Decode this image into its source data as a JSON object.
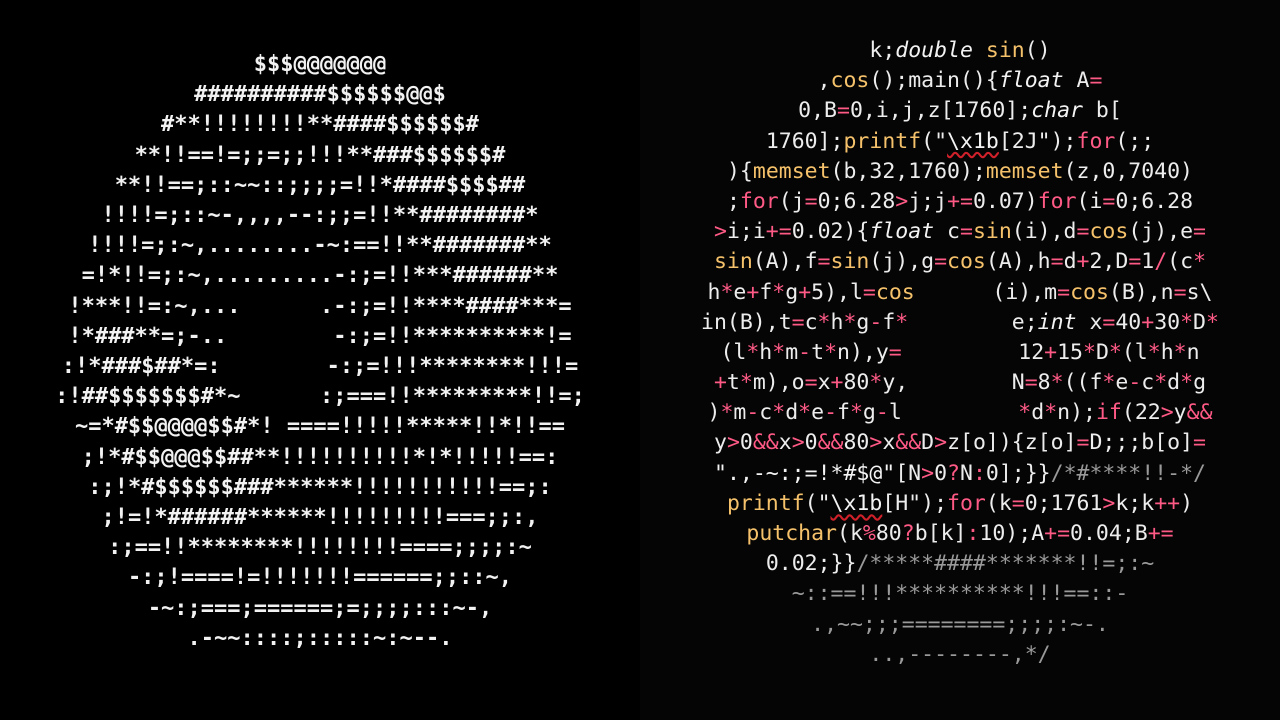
{
  "left_ascii": {
    "lines": [
      "$$$@@@@@@@",
      "##########$$$$$$@@$",
      "#**!!!!!!!!**####$$$$$$#",
      "**!!==!=;;=;;!!!**###$$$$$$#",
      "**!!==;::~~::;;;;=!!*####$$$$##",
      "!!!!=;::~-,,,,--:;;=!!**########*",
      "!!!!=;:~,........-~:==!!**#######**",
      "=!*!!=;:~,.........-:;=!!***######**",
      "!***!!=:~,...      .-:;=!!****####***=",
      "!*###**=;-..        -:;=!!**********!=",
      ":!*###$##*=:        -:;=!!!********!!!=",
      ":!##$$$$$$$#*~      :;===!!*********!!=;",
      "~=*#$$@@@@$$#*! ====!!!!!*****!!*!!==",
      ";!*#$$@@@$$##**!!!!!!!!!!*!*!!!!!==:",
      ":;!*#$$$$$$###******!!!!!!!!!!!==;:",
      ";!=!*######******!!!!!!!!!===;;:,",
      ":;==!!********!!!!!!!!====;;;;:~",
      "-:;!====!=!!!!!!!======;;::~,",
      "-~:;===;======;=;;;;:::~-,",
      ".-~~::::;:::::~:~--."
    ]
  },
  "right_code": {
    "lines": [
      [
        [
          "t",
          "k;"
        ],
        [
          "it",
          "double"
        ],
        [
          "t",
          " "
        ],
        [
          "fn",
          "sin"
        ],
        [
          "t",
          "()"
        ]
      ],
      [
        [
          "t",
          ","
        ],
        [
          "fn",
          "cos"
        ],
        [
          "t",
          "();main(){"
        ],
        [
          "it",
          "float"
        ],
        [
          "t",
          " A"
        ],
        [
          "op",
          "="
        ]
      ],
      [
        [
          "t",
          "0,B"
        ],
        [
          "op",
          "="
        ],
        [
          "t",
          "0,i,j,z[1760];"
        ],
        [
          "it",
          "char"
        ],
        [
          "t",
          " b["
        ]
      ],
      [
        [
          "t",
          "1760];"
        ],
        [
          "fn",
          "printf"
        ],
        [
          "t",
          "(\""
        ],
        [
          "esc",
          "\\x1b"
        ],
        [
          "t",
          "[2J\");"
        ],
        [
          "kw",
          "for"
        ],
        [
          "t",
          "(;;"
        ]
      ],
      [
        [
          "t",
          ")"
        ],
        [
          "t",
          "{"
        ],
        [
          "fn",
          "memset"
        ],
        [
          "t",
          "(b,32,1760);"
        ],
        [
          "fn",
          "memset"
        ],
        [
          "t",
          "(z,0,7040)"
        ]
      ],
      [
        [
          "t",
          ";"
        ],
        [
          "kw",
          "for"
        ],
        [
          "t",
          "(j"
        ],
        [
          "op",
          "="
        ],
        [
          "t",
          "0;6.28"
        ],
        [
          "op",
          ">"
        ],
        [
          "t",
          "j;j"
        ],
        [
          "op",
          "+="
        ],
        [
          "t",
          "0.07)"
        ],
        [
          "kw",
          "for"
        ],
        [
          "t",
          "(i"
        ],
        [
          "op",
          "="
        ],
        [
          "t",
          "0;6.28"
        ]
      ],
      [
        [
          "op",
          ">"
        ],
        [
          "t",
          "i;i"
        ],
        [
          "op",
          "+="
        ],
        [
          "t",
          "0.02){"
        ],
        [
          "it",
          "float"
        ],
        [
          "t",
          " c"
        ],
        [
          "op",
          "="
        ],
        [
          "fn",
          "sin"
        ],
        [
          "t",
          "(i),d"
        ],
        [
          "op",
          "="
        ],
        [
          "fn",
          "cos"
        ],
        [
          "t",
          "(j),e"
        ],
        [
          "op",
          "="
        ]
      ],
      [
        [
          "fn",
          "sin"
        ],
        [
          "t",
          "(A),f"
        ],
        [
          "op",
          "="
        ],
        [
          "fn",
          "sin"
        ],
        [
          "t",
          "(j),g"
        ],
        [
          "op",
          "="
        ],
        [
          "fn",
          "cos"
        ],
        [
          "t",
          "(A),h"
        ],
        [
          "op",
          "="
        ],
        [
          "t",
          "d"
        ],
        [
          "op",
          "+"
        ],
        [
          "t",
          "2,D"
        ],
        [
          "op",
          "="
        ],
        [
          "t",
          "1"
        ],
        [
          "op",
          "/"
        ],
        [
          "t",
          "(c"
        ],
        [
          "op",
          "*"
        ]
      ],
      [
        [
          "t",
          "h"
        ],
        [
          "op",
          "*"
        ],
        [
          "t",
          "e"
        ],
        [
          "op",
          "+"
        ],
        [
          "t",
          "f"
        ],
        [
          "op",
          "*"
        ],
        [
          "t",
          "g"
        ],
        [
          "op",
          "+"
        ],
        [
          "t",
          "5),l"
        ],
        [
          "op",
          "="
        ],
        [
          "fn",
          "cos"
        ],
        [
          "t",
          "      (i),m"
        ],
        [
          "op",
          "="
        ],
        [
          "fn",
          "cos"
        ],
        [
          "t",
          "(B),n"
        ],
        [
          "op",
          "="
        ],
        [
          "t",
          "s\\"
        ]
      ],
      [
        [
          "t",
          "in(B),t"
        ],
        [
          "op",
          "="
        ],
        [
          "t",
          "c"
        ],
        [
          "op",
          "*"
        ],
        [
          "t",
          "h"
        ],
        [
          "op",
          "*"
        ],
        [
          "t",
          "g"
        ],
        [
          "op",
          "-"
        ],
        [
          "t",
          "f"
        ],
        [
          "op",
          "*"
        ],
        [
          "t",
          "        e;"
        ],
        [
          "it",
          "int"
        ],
        [
          "t",
          " x"
        ],
        [
          "op",
          "="
        ],
        [
          "t",
          "40"
        ],
        [
          "op",
          "+"
        ],
        [
          "t",
          "30"
        ],
        [
          "op",
          "*"
        ],
        [
          "t",
          "D"
        ],
        [
          "op",
          "*"
        ]
      ],
      [
        [
          "t",
          "(l"
        ],
        [
          "op",
          "*"
        ],
        [
          "t",
          "h"
        ],
        [
          "op",
          "*"
        ],
        [
          "t",
          "m"
        ],
        [
          "op",
          "-"
        ],
        [
          "t",
          "t"
        ],
        [
          "op",
          "*"
        ],
        [
          "t",
          "n),y"
        ],
        [
          "op",
          "="
        ],
        [
          "t",
          "         12"
        ],
        [
          "op",
          "+"
        ],
        [
          "t",
          "15"
        ],
        [
          "op",
          "*"
        ],
        [
          "t",
          "D"
        ],
        [
          "op",
          "*"
        ],
        [
          "t",
          "(l"
        ],
        [
          "op",
          "*"
        ],
        [
          "t",
          "h"
        ],
        [
          "op",
          "*"
        ],
        [
          "t",
          "n"
        ]
      ],
      [
        [
          "op",
          "+"
        ],
        [
          "t",
          "t"
        ],
        [
          "op",
          "*"
        ],
        [
          "t",
          "m),o"
        ],
        [
          "op",
          "="
        ],
        [
          "t",
          "x"
        ],
        [
          "op",
          "+"
        ],
        [
          "t",
          "80"
        ],
        [
          "op",
          "*"
        ],
        [
          "t",
          "y,        N"
        ],
        [
          "op",
          "="
        ],
        [
          "t",
          "8"
        ],
        [
          "op",
          "*"
        ],
        [
          "t",
          "((f"
        ],
        [
          "op",
          "*"
        ],
        [
          "t",
          "e"
        ],
        [
          "op",
          "-"
        ],
        [
          "t",
          "c"
        ],
        [
          "op",
          "*"
        ],
        [
          "t",
          "d"
        ],
        [
          "op",
          "*"
        ],
        [
          "t",
          "g"
        ]
      ],
      [
        [
          "t",
          ")"
        ],
        [
          "op",
          "*"
        ],
        [
          "t",
          "m"
        ],
        [
          "op",
          "-"
        ],
        [
          "t",
          "c"
        ],
        [
          "op",
          "*"
        ],
        [
          "t",
          "d"
        ],
        [
          "op",
          "*"
        ],
        [
          "t",
          "e"
        ],
        [
          "op",
          "-"
        ],
        [
          "t",
          "f"
        ],
        [
          "op",
          "*"
        ],
        [
          "t",
          "g"
        ],
        [
          "op",
          "-"
        ],
        [
          "t",
          "l         "
        ],
        [
          "op",
          "*"
        ],
        [
          "t",
          "d"
        ],
        [
          "op",
          "*"
        ],
        [
          "t",
          "n);"
        ],
        [
          "kw",
          "if"
        ],
        [
          "t",
          "(22"
        ],
        [
          "op",
          ">"
        ],
        [
          "t",
          "y"
        ],
        [
          "op",
          "&&"
        ]
      ],
      [
        [
          "t",
          "y"
        ],
        [
          "op",
          ">"
        ],
        [
          "t",
          "0"
        ],
        [
          "op",
          "&&"
        ],
        [
          "t",
          "x"
        ],
        [
          "op",
          ">"
        ],
        [
          "t",
          "0"
        ],
        [
          "op",
          "&&"
        ],
        [
          "t",
          "80"
        ],
        [
          "op",
          ">"
        ],
        [
          "t",
          "x"
        ],
        [
          "op",
          "&&"
        ],
        [
          "t",
          "D"
        ],
        [
          "op",
          ">"
        ],
        [
          "t",
          "z[o]){z[o]"
        ],
        [
          "op",
          "="
        ],
        [
          "t",
          "D;;;b[o]"
        ],
        [
          "op",
          "="
        ]
      ],
      [
        [
          "str",
          "\".,-~:;=!*#$@\""
        ],
        [
          "t",
          "[N"
        ],
        [
          "op",
          ">"
        ],
        [
          "t",
          "0"
        ],
        [
          "op",
          "?"
        ],
        [
          "t",
          "N"
        ],
        [
          "op",
          ":"
        ],
        [
          "t",
          "0];}}"
        ],
        [
          "cm",
          "/*#****!!-*/"
        ]
      ],
      [
        [
          "fn",
          "printf"
        ],
        [
          "t",
          "(\""
        ],
        [
          "esc",
          "\\x1b"
        ],
        [
          "t",
          "[H\");"
        ],
        [
          "kw",
          "for"
        ],
        [
          "t",
          "(k"
        ],
        [
          "op",
          "="
        ],
        [
          "t",
          "0;1761"
        ],
        [
          "op",
          ">"
        ],
        [
          "t",
          "k;k"
        ],
        [
          "op",
          "++"
        ],
        [
          "t",
          ")"
        ]
      ],
      [
        [
          "fn",
          "putchar"
        ],
        [
          "t",
          "(k"
        ],
        [
          "op",
          "%"
        ],
        [
          "t",
          "80"
        ],
        [
          "op",
          "?"
        ],
        [
          "t",
          "b[k]"
        ],
        [
          "op",
          ":"
        ],
        [
          "t",
          "10);A"
        ],
        [
          "op",
          "+="
        ],
        [
          "t",
          "0.04;B"
        ],
        [
          "op",
          "+="
        ]
      ],
      [
        [
          "t",
          "0.02;}}"
        ],
        [
          "cm",
          "/*****####*******!!=;:~"
        ]
      ],
      [
        [
          "cm",
          "~::==!!!**********!!!==::-"
        ]
      ],
      [
        [
          "cm",
          ".,~~;;;========;;;;:~-."
        ]
      ],
      [
        [
          "cm",
          "..,--------,*/"
        ]
      ]
    ]
  }
}
